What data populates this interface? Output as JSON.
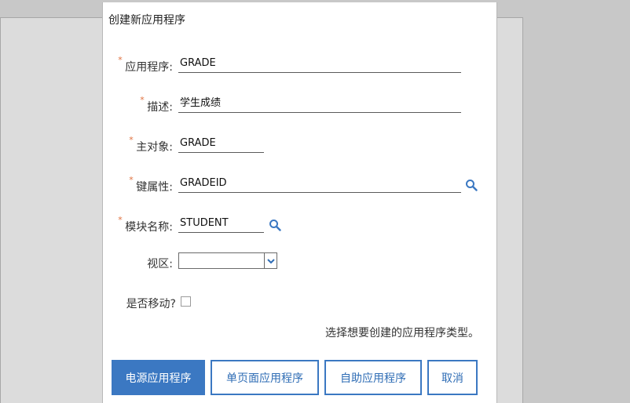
{
  "dialog": {
    "title": "创建新应用程序",
    "fields": {
      "application": {
        "label": "应用程序:",
        "value": "GRADE"
      },
      "description": {
        "label": "描述:",
        "value": "学生成绩"
      },
      "main_object": {
        "label": "主对象:",
        "value": "GRADE"
      },
      "key_attribute": {
        "label": "键属性:",
        "value": "GRADEID"
      },
      "module_name": {
        "label": "模块名称:",
        "value": "STUDENT"
      },
      "view_area": {
        "label": "视区:",
        "value": ""
      },
      "is_mobile": {
        "label": "是否移动?",
        "checked": false
      }
    },
    "hint": "选择想要创建的应用程序类型。",
    "buttons": {
      "power_app": "电源应用程序",
      "single_page_app": "单页面应用程序",
      "self_service_app": "自助应用程序",
      "cancel": "取消"
    }
  },
  "colors": {
    "accent": "#3b78c2",
    "required": "#e0703d",
    "backdrop": "#c8c8c8"
  },
  "icons": {
    "lookup": "search-icon",
    "dropdown": "chevron-down-icon"
  }
}
